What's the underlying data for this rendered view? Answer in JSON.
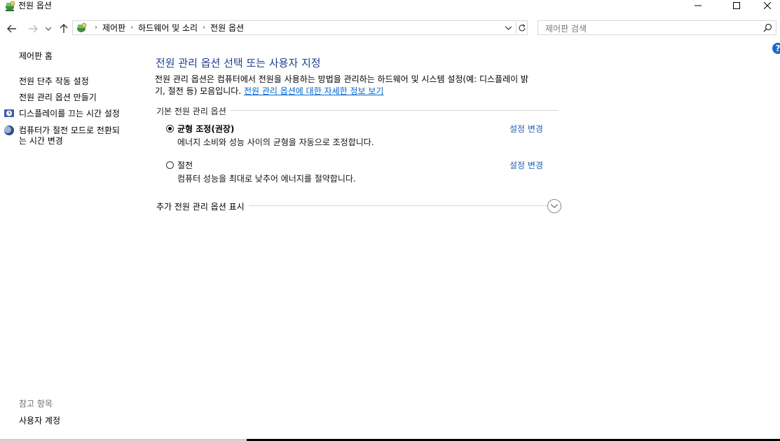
{
  "window": {
    "title": "전원 옵션"
  },
  "nav": {
    "breadcrumb": [
      "제어판",
      "하드웨어 및 소리",
      "전원 옵션"
    ],
    "search_placeholder": "제어판 검색"
  },
  "sidebar": {
    "home": "제어판 홈",
    "links": [
      "전원 단추 작동 설정",
      "전원 관리 옵션 만들기",
      "디스플레이를 끄는 시간 설정",
      "컴퓨터가 절전 모드로 전환되",
      "는 시간 변경"
    ],
    "see_also_label": "참고 항목",
    "see_also_links": [
      "사용자 계정"
    ]
  },
  "main": {
    "heading": "전원 관리 옵션 선택 또는 사용자 지정",
    "description_line1": "전원 관리 옵션은 컴퓨터에서 전원을 사용하는 방법을 관리하는 하드웨어 및 시스템 설정(예: 디스플레이 밝",
    "description_line2": "기, 절전 등) 모음입니다. ",
    "description_link": "전원 관리 옵션에 대한 자세한 정보 보기",
    "group_label": "기본 전원 관리 옵션",
    "plans": [
      {
        "name": "균형 조정(권장)",
        "description": "에너지 소비와 성능 사이의 균형을 자동으로 조정합니다.",
        "link": "설정 변경",
        "selected": true
      },
      {
        "name": "절전",
        "description": "컴퓨터 성능을 최대로 낮추어 에너지를 절약합니다.",
        "link": "설정 변경",
        "selected": false
      }
    ],
    "more_plans_label": "추가 전원 관리 옵션 표시"
  },
  "icons": {
    "app": "power-options-icon",
    "help": "help-icon",
    "help_glyph": "?"
  }
}
